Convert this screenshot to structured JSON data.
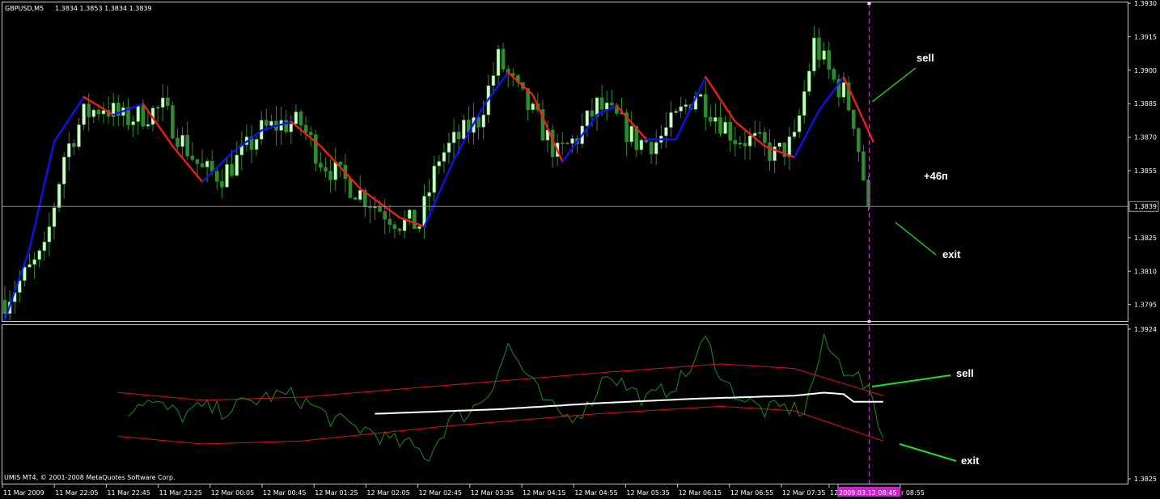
{
  "header": {
    "symbol": "GBPUSD,M5",
    "ohlc": "1.3834 1.3853 1.3834 1.3839"
  },
  "copyright": "UMIS MT4, © 2001-2008 MetaQuotes Software Corp.",
  "colors": {
    "background": "#000000",
    "frame": "#c8c8c8",
    "bull_candle": "#ccffcc",
    "bear_candle": "#2e8b2e",
    "ma_rising": "#1010ff",
    "ma_falling": "#ff1a1a",
    "oscillator": "#1d8a1d",
    "band": "#e01010",
    "osc_mid": "#ffffff",
    "annotation_line": "#22dd22",
    "vline": "#cc33cc",
    "time_highlight": "#cc22cc"
  },
  "annotations": {
    "main_sell": "sell",
    "main_exit": "exit",
    "profit": "+46п",
    "osc_sell": "sell",
    "osc_exit": "exit"
  },
  "chart_data": [
    {
      "type": "candlestick",
      "title": "GBPUSD,M5",
      "ylim": [
        1.3788,
        1.393
      ],
      "yticks": [
        "1.3930",
        "1.3915",
        "1.3900",
        "1.3885",
        "1.3870",
        "1.3855",
        "1.3839",
        "1.3825",
        "1.3810",
        "1.3795"
      ],
      "current_price": "1.3839",
      "xtick_labels": [
        "11 Mar 2009",
        "11 Mar 22:05",
        "11 Mar 22:45",
        "11 Mar 23:25",
        "12 Mar 00:05",
        "12 Mar 00:45",
        "12 Mar 01:25",
        "12 Mar 02:05",
        "12 Mar 02:45",
        "12 Mar 03:35",
        "12 Mar 04:15",
        "12 Mar 04:55",
        "12 Mar 05:35",
        "12 Mar 06:15",
        "12 Mar 06:55",
        "12 Mar 07:35",
        "12 ",
        "2009.03.12 08:45",
        "r 08:55"
      ],
      "marked_time": "2009.03.12 08:45",
      "price_anchors": [
        [
          0,
          1.3797
        ],
        [
          4,
          1.3808
        ],
        [
          8,
          1.3818
        ],
        [
          12,
          1.3862
        ],
        [
          16,
          1.388
        ],
        [
          20,
          1.3884
        ],
        [
          24,
          1.3878
        ],
        [
          28,
          1.388
        ],
        [
          32,
          1.3883
        ],
        [
          36,
          1.3868
        ],
        [
          40,
          1.3855
        ],
        [
          44,
          1.3853
        ],
        [
          48,
          1.3862
        ],
        [
          52,
          1.3873
        ],
        [
          56,
          1.3876
        ],
        [
          60,
          1.3876
        ],
        [
          64,
          1.386
        ],
        [
          68,
          1.3852
        ],
        [
          72,
          1.3845
        ],
        [
          76,
          1.3838
        ],
        [
          80,
          1.3832
        ],
        [
          84,
          1.3831
        ],
        [
          88,
          1.3861
        ],
        [
          92,
          1.387
        ],
        [
          96,
          1.3878
        ],
        [
          100,
          1.3905
        ],
        [
          104,
          1.389
        ],
        [
          108,
          1.3877
        ],
        [
          112,
          1.3862
        ],
        [
          116,
          1.387
        ],
        [
          120,
          1.3884
        ],
        [
          124,
          1.3878
        ],
        [
          128,
          1.3868
        ],
        [
          132,
          1.3868
        ],
        [
          136,
          1.3878
        ],
        [
          140,
          1.389
        ],
        [
          144,
          1.388
        ],
        [
          148,
          1.387
        ],
        [
          152,
          1.3868
        ],
        [
          156,
          1.3862
        ],
        [
          160,
          1.3868
        ],
        [
          164,
          1.3912
        ],
        [
          168,
          1.3895
        ],
        [
          170,
          1.389
        ],
        [
          172,
          1.3878
        ],
        [
          175,
          1.3839
        ]
      ],
      "ma_anchors": [
        [
          0,
          1.3788
        ],
        [
          5,
          1.382
        ],
        [
          10,
          1.3868
        ],
        [
          16,
          1.3888
        ],
        [
          22,
          1.388
        ],
        [
          28,
          1.3885
        ],
        [
          34,
          1.3866
        ],
        [
          40,
          1.385
        ],
        [
          46,
          1.3863
        ],
        [
          52,
          1.3873
        ],
        [
          58,
          1.3877
        ],
        [
          64,
          1.3866
        ],
        [
          72,
          1.3847
        ],
        [
          80,
          1.3834
        ],
        [
          85,
          1.383
        ],
        [
          91,
          1.386
        ],
        [
          97,
          1.3884
        ],
        [
          102,
          1.3899
        ],
        [
          107,
          1.3889
        ],
        [
          113,
          1.3859
        ],
        [
          120,
          1.388
        ],
        [
          124,
          1.3884
        ],
        [
          130,
          1.3869
        ],
        [
          136,
          1.3869
        ],
        [
          142,
          1.3897
        ],
        [
          148,
          1.3877
        ],
        [
          154,
          1.3866
        ],
        [
          160,
          1.3861
        ],
        [
          165,
          1.3882
        ],
        [
          170,
          1.3897
        ],
        [
          176,
          1.3868
        ]
      ],
      "ma_colors": {
        "rising": "#1010ff",
        "falling": "#ff1a1a"
      }
    },
    {
      "type": "line",
      "title": "",
      "ylim": [
        1.3825,
        1.3924
      ],
      "yticks": [
        "1.3924",
        "1.3825"
      ],
      "series": [
        {
          "type": "oscillator",
          "anchors": [
            [
              0,
              1.388
            ],
            [
              4,
              1.3887
            ],
            [
              8,
              1.3883
            ],
            [
              12,
              1.3893
            ],
            [
              16,
              1.3877
            ],
            [
              20,
              1.3864
            ],
            [
              24,
              1.3869
            ],
            [
              28,
              1.3877
            ],
            [
              32,
              1.3872
            ],
            [
              36,
              1.3867
            ],
            [
              40,
              1.3872
            ],
            [
              44,
              1.387
            ],
            [
              50,
              1.3876
            ],
            [
              54,
              1.388
            ],
            [
              58,
              1.388
            ],
            [
              62,
              1.3874
            ],
            [
              66,
              1.3865
            ],
            [
              70,
              1.386
            ],
            [
              74,
              1.3857
            ],
            [
              78,
              1.385
            ],
            [
              82,
              1.3847
            ],
            [
              86,
              1.384
            ],
            [
              90,
              1.3864
            ],
            [
              94,
              1.3869
            ],
            [
              98,
              1.3882
            ],
            [
              102,
              1.3913
            ],
            [
              106,
              1.3892
            ],
            [
              110,
              1.3873
            ],
            [
              114,
              1.3866
            ],
            [
              118,
              1.3872
            ],
            [
              122,
              1.3896
            ],
            [
              126,
              1.3886
            ],
            [
              130,
              1.3877
            ],
            [
              134,
              1.3884
            ],
            [
              138,
              1.3893
            ],
            [
              142,
              1.3917
            ],
            [
              146,
              1.3888
            ],
            [
              150,
              1.3877
            ],
            [
              154,
              1.387
            ],
            [
              158,
              1.3872
            ],
            [
              162,
              1.387
            ],
            [
              166,
              1.3915
            ],
            [
              170,
              1.3898
            ],
            [
              172,
              1.3897
            ],
            [
              176,
              1.3876
            ],
            [
              178,
              1.3852
            ]
          ]
        },
        {
          "type": "upper_band",
          "anchors": [
            [
              0,
              1.3903
            ],
            [
              20,
              1.3883
            ],
            [
              40,
              1.3877
            ],
            [
              60,
              1.3879
            ],
            [
              90,
              1.3887
            ],
            [
              120,
              1.3895
            ],
            [
              145,
              1.3901
            ],
            [
              160,
              1.3898
            ],
            [
              178,
              1.388
            ]
          ]
        },
        {
          "type": "lower_band",
          "anchors": [
            [
              0,
              1.3878
            ],
            [
              20,
              1.3854
            ],
            [
              40,
              1.3848
            ],
            [
              60,
              1.385
            ],
            [
              90,
              1.386
            ],
            [
              120,
              1.3868
            ],
            [
              145,
              1.3873
            ],
            [
              160,
              1.387
            ],
            [
              178,
              1.385
            ]
          ]
        },
        {
          "type": "midline",
          "anchors": [
            [
              75,
              1.3868
            ],
            [
              100,
              1.3871
            ],
            [
              120,
              1.3875
            ],
            [
              140,
              1.3878
            ],
            [
              160,
              1.388
            ],
            [
              166,
              1.3882
            ],
            [
              170,
              1.3881
            ],
            [
              172,
              1.3876
            ],
            [
              178,
              1.3876
            ]
          ]
        }
      ]
    }
  ]
}
